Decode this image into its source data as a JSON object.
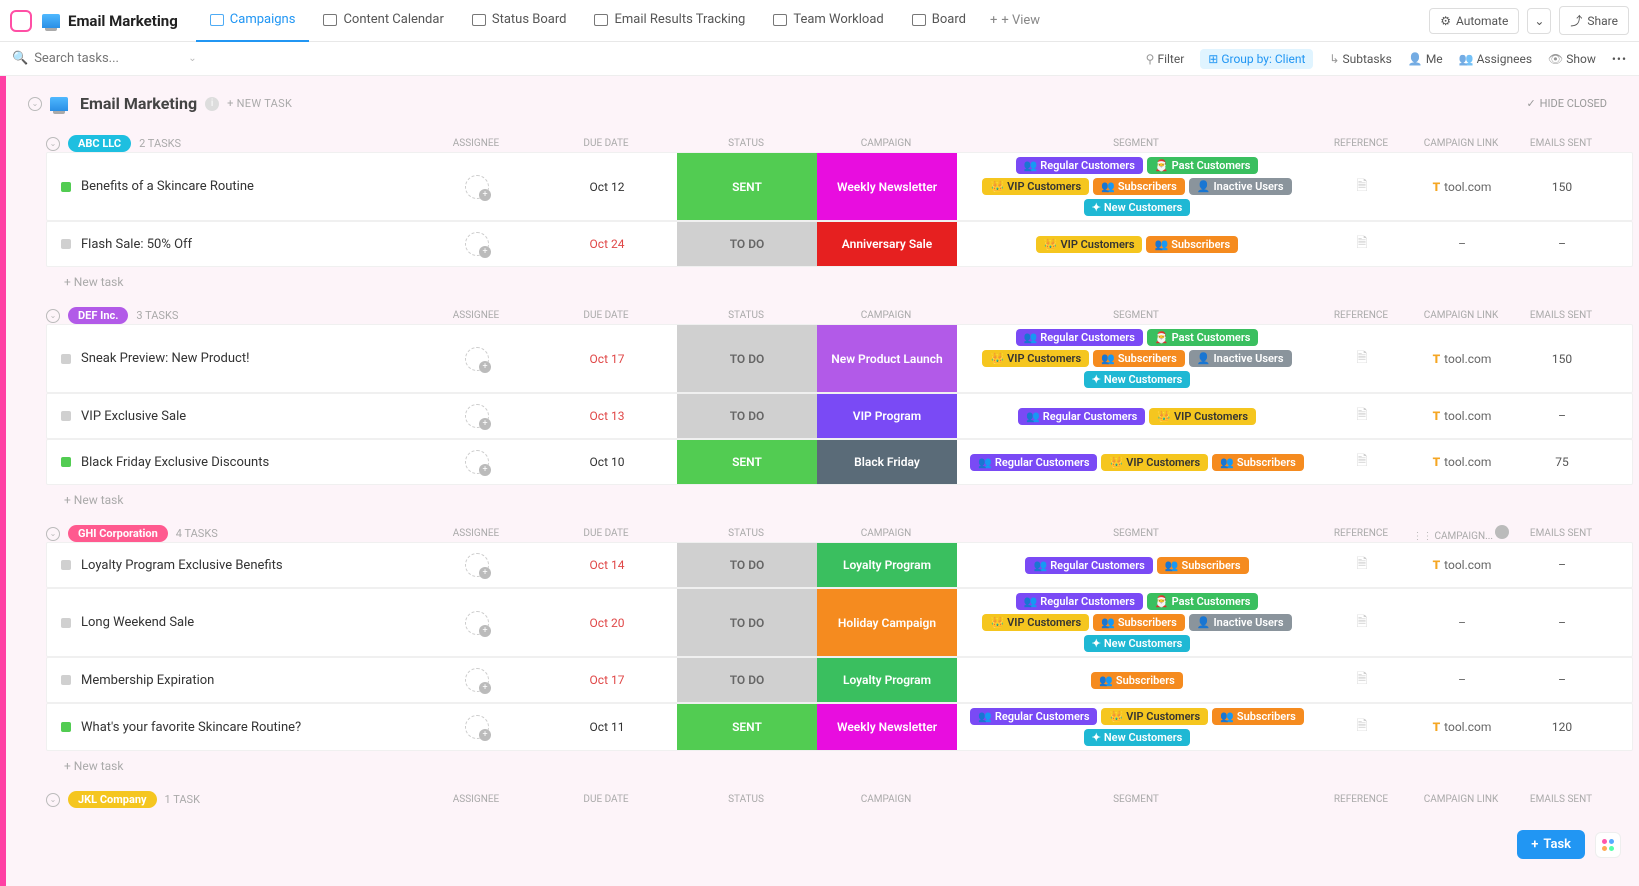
{
  "header": {
    "title": "Email Marketing",
    "tabs": [
      "Campaigns",
      "Content Calendar",
      "Status Board",
      "Email Results Tracking",
      "Team Workload",
      "Board"
    ],
    "active_tab": 0,
    "add_view": "+ View",
    "automate": "Automate",
    "share": "Share"
  },
  "toolbar": {
    "search_placeholder": "Search tasks...",
    "filter": "Filter",
    "group_by": "Group by: Client",
    "subtasks": "Subtasks",
    "me": "Me",
    "assignees": "Assignees",
    "show": "Show"
  },
  "list": {
    "title": "Email Marketing",
    "new_task": "+ NEW TASK",
    "hide_closed": "HIDE CLOSED"
  },
  "columns": [
    "ASSIGNEE",
    "DUE DATE",
    "STATUS",
    "CAMPAIGN",
    "SEGMENT",
    "REFERENCE",
    "CAMPAIGN LINK",
    "EMAILS SENT"
  ],
  "col_moving": "CAMPAIGN...",
  "groups": [
    {
      "name": "ABC LLC",
      "color": "#1ebfe0",
      "count": "2 TASKS",
      "tasks": [
        {
          "sq": "green",
          "name": "Benefits of a Skincare Routine",
          "due": "Oct 12",
          "due_red": false,
          "status": "SENT",
          "status_cls": "status-sent",
          "camp": "Weekly Newsletter",
          "camp_cls": "camp-weekly",
          "segments": [
            [
              "seg-regular",
              "Regular Customers"
            ],
            [
              "seg-past",
              "Past Customers"
            ],
            [
              "seg-vip",
              "VIP Customers"
            ],
            [
              "seg-sub",
              "Subscribers"
            ],
            [
              "seg-inactive",
              "Inactive Users"
            ],
            [
              "seg-new",
              "New Customers"
            ]
          ],
          "link": "tool.com",
          "sent": "150"
        },
        {
          "sq": "grey",
          "name": "Flash Sale: 50% Off",
          "due": "Oct 24",
          "due_red": true,
          "status": "TO DO",
          "status_cls": "status-todo",
          "camp": "Anniversary Sale",
          "camp_cls": "camp-anniv",
          "segments": [
            [
              "seg-vip",
              "VIP Customers"
            ],
            [
              "seg-sub",
              "Subscribers"
            ]
          ],
          "link": "–",
          "sent": "–"
        }
      ]
    },
    {
      "name": "DEF Inc.",
      "color": "#b25ae8",
      "count": "3 TASKS",
      "tasks": [
        {
          "sq": "grey",
          "name": "Sneak Preview: New Product!",
          "due": "Oct 17",
          "due_red": true,
          "status": "TO DO",
          "status_cls": "status-todo",
          "camp": "New Product Launch",
          "camp_cls": "camp-newprod",
          "segments": [
            [
              "seg-regular",
              "Regular Customers"
            ],
            [
              "seg-past",
              "Past Customers"
            ],
            [
              "seg-vip",
              "VIP Customers"
            ],
            [
              "seg-sub",
              "Subscribers"
            ],
            [
              "seg-inactive",
              "Inactive Users"
            ],
            [
              "seg-new",
              "New Customers"
            ]
          ],
          "link": "tool.com",
          "sent": "150"
        },
        {
          "sq": "grey",
          "name": "VIP Exclusive Sale",
          "due": "Oct 13",
          "due_red": true,
          "status": "TO DO",
          "status_cls": "status-todo",
          "camp": "VIP Program",
          "camp_cls": "camp-vip",
          "segments": [
            [
              "seg-regular",
              "Regular Customers"
            ],
            [
              "seg-vip",
              "VIP Customers"
            ]
          ],
          "link": "tool.com",
          "sent": "–"
        },
        {
          "sq": "green",
          "name": "Black Friday Exclusive Discounts",
          "due": "Oct 10",
          "due_red": false,
          "status": "SENT",
          "status_cls": "status-sent",
          "camp": "Black Friday",
          "camp_cls": "camp-blackf",
          "segments": [
            [
              "seg-regular",
              "Regular Customers"
            ],
            [
              "seg-vip",
              "VIP Customers"
            ],
            [
              "seg-sub",
              "Subscribers"
            ]
          ],
          "link": "tool.com",
          "sent": "75"
        }
      ]
    },
    {
      "name": "GHI Corporation",
      "color": "#ff5a8f",
      "count": "4 TASKS",
      "col_drag": true,
      "tasks": [
        {
          "sq": "grey",
          "name": "Loyalty Program Exclusive Benefits",
          "due": "Oct 14",
          "due_red": true,
          "status": "TO DO",
          "status_cls": "status-todo",
          "camp": "Loyalty Program",
          "camp_cls": "camp-loyalty",
          "segments": [
            [
              "seg-regular",
              "Regular Customers"
            ],
            [
              "seg-sub",
              "Subscribers"
            ]
          ],
          "link": "tool.com",
          "sent": "–"
        },
        {
          "sq": "grey",
          "name": "Long Weekend Sale",
          "due": "Oct 20",
          "due_red": true,
          "status": "TO DO",
          "status_cls": "status-todo",
          "camp": "Holiday Campaign",
          "camp_cls": "camp-holiday",
          "segments": [
            [
              "seg-regular",
              "Regular Customers"
            ],
            [
              "seg-past",
              "Past Customers"
            ],
            [
              "seg-vip",
              "VIP Customers"
            ],
            [
              "seg-sub",
              "Subscribers"
            ],
            [
              "seg-inactive",
              "Inactive Users"
            ],
            [
              "seg-new",
              "New Customers"
            ]
          ],
          "link": "–",
          "sent": "–"
        },
        {
          "sq": "grey",
          "name": "Membership Expiration",
          "due": "Oct 17",
          "due_red": true,
          "status": "TO DO",
          "status_cls": "status-todo",
          "camp": "Loyalty Program",
          "camp_cls": "camp-loyalty",
          "segments": [
            [
              "seg-sub",
              "Subscribers"
            ]
          ],
          "link": "–",
          "sent": "–"
        },
        {
          "sq": "green",
          "name": "What's your favorite Skincare Routine?",
          "due": "Oct 11",
          "due_red": false,
          "status": "SENT",
          "status_cls": "status-sent",
          "camp": "Weekly Newsletter",
          "camp_cls": "camp-weekly",
          "segments": [
            [
              "seg-regular",
              "Regular Customers"
            ],
            [
              "seg-vip",
              "VIP Customers"
            ],
            [
              "seg-sub",
              "Subscribers"
            ],
            [
              "seg-new",
              "New Customers"
            ]
          ],
          "link": "tool.com",
          "sent": "120"
        }
      ]
    },
    {
      "name": "JKL Company",
      "color": "#f5c61f",
      "count": "1 TASK",
      "partial": true,
      "tasks": []
    }
  ],
  "new_task_row": "+ New task",
  "fab": {
    "task": "Task"
  }
}
